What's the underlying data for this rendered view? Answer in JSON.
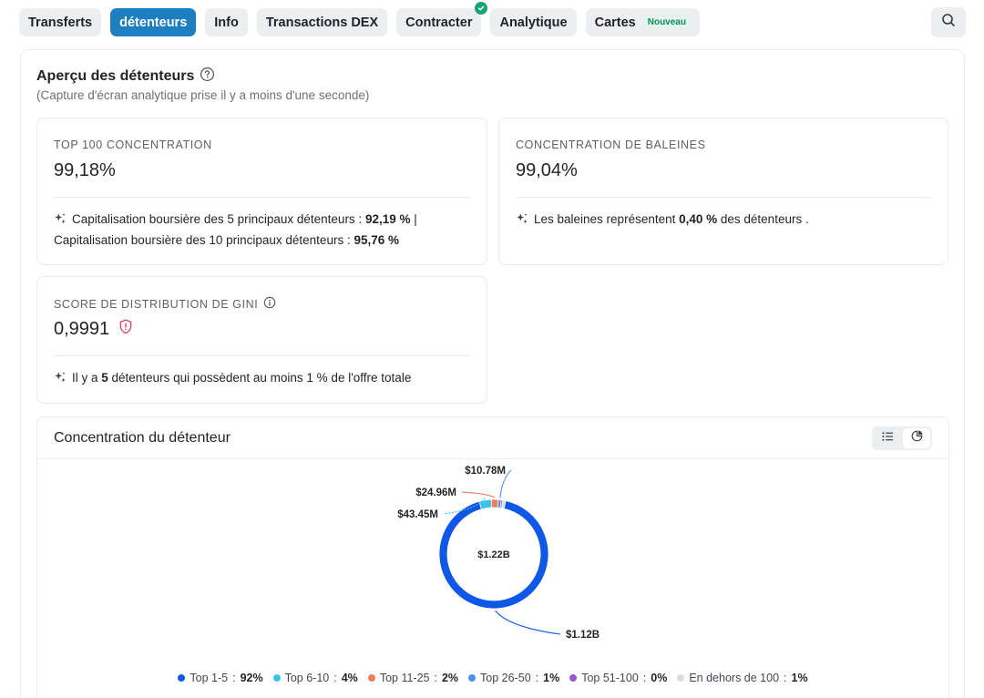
{
  "tabs": [
    {
      "label": "Transferts",
      "active": false
    },
    {
      "label": "détenteurs",
      "active": true
    },
    {
      "label": "Info",
      "active": false
    },
    {
      "label": "Transactions DEX",
      "active": false
    },
    {
      "label": "Contracter",
      "active": false,
      "verified": true
    },
    {
      "label": "Analytique",
      "active": false
    },
    {
      "label": "Cartes",
      "active": false,
      "badge": "Nouveau"
    }
  ],
  "overview": {
    "title": "Aperçu des détenteurs",
    "subtitle": "(Capture d'écran analytique prise il y a moins d'une seconde)"
  },
  "cards": {
    "top100": {
      "label": "TOP 100 CONCENTRATION",
      "value": "99,18%",
      "note_a": "Capitalisation boursière des 5 principaux détenteurs : ",
      "note_a_val": "92,19 %",
      "note_sep": " |",
      "note_b": "Capitalisation boursière des 10 principaux détenteurs : ",
      "note_b_val": "95,76 %"
    },
    "whales": {
      "label": "CONCENTRATION DE BALEINES",
      "value": "99,04%",
      "note_a": "Les baleines représentent ",
      "note_val": "0,40 %",
      "note_b": " des détenteurs ."
    },
    "gini": {
      "label": "SCORE DE DISTRIBUTION DE GINI",
      "value": "0,9991",
      "note_a": "Il y a ",
      "note_val": "5",
      "note_b": " détenteurs qui possèdent au moins 1 % de l'offre totale"
    }
  },
  "chart_card": {
    "title": "Concentration du détenteur"
  },
  "colors": {
    "accent": "#1c7fc0",
    "verified": "#18a572",
    "warning": "#d9455a"
  },
  "chart_data": {
    "type": "pie",
    "center_label": "$1.22B",
    "slices": [
      {
        "name": "Top 1-5",
        "percent_label": "92%",
        "percent": 92.19,
        "value_label": "$1.12B",
        "color": "#0f57e6"
      },
      {
        "name": "Top 6-10",
        "percent_label": "4%",
        "percent": 3.57,
        "value_label": "$43.45M",
        "color": "#3ec3e8"
      },
      {
        "name": "Top 11-25",
        "percent_label": "2%",
        "percent": 2.05,
        "value_label": "$24.96M",
        "color": "#ee7d5e"
      },
      {
        "name": "Top 26-50",
        "percent_label": "1%",
        "percent": 0.89,
        "value_label": "$10.78M",
        "color": "#4f8fe8"
      },
      {
        "name": "Top 51-100",
        "percent_label": "0%",
        "percent": 0.48,
        "value_label": "",
        "color": "#9b55d8"
      },
      {
        "name": "En dehors de 100",
        "percent_label": "1%",
        "percent": 0.82,
        "value_label": "",
        "color": "#d9dde2"
      }
    ],
    "legend_position": "bottom"
  }
}
